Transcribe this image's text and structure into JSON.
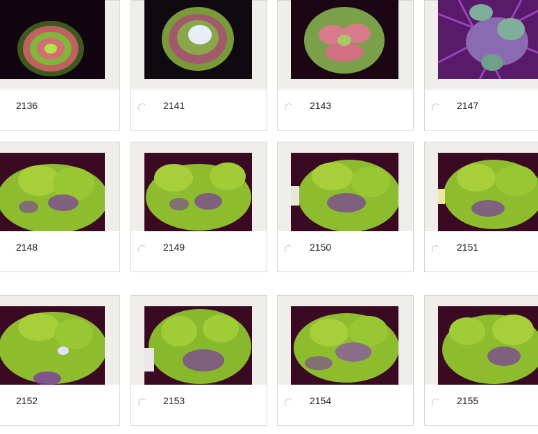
{
  "gallery": {
    "items": [
      {
        "label": "2136",
        "kind": "flower-green-pink"
      },
      {
        "label": "2141",
        "kind": "flower-green-white"
      },
      {
        "label": "2143",
        "kind": "brain-green-pink"
      },
      {
        "label": "2147",
        "kind": "purple-rock"
      },
      {
        "label": "2148",
        "kind": "green-carpet"
      },
      {
        "label": "2149",
        "kind": "green-carpet"
      },
      {
        "label": "2150",
        "kind": "green-carpet"
      },
      {
        "label": "2151",
        "kind": "green-carpet"
      },
      {
        "label": "2152",
        "kind": "green-carpet"
      },
      {
        "label": "2153",
        "kind": "green-carpet"
      },
      {
        "label": "2154",
        "kind": "green-carpet"
      },
      {
        "label": "2155",
        "kind": "green-carpet"
      }
    ]
  },
  "colors": {
    "frame": "#efeeea",
    "photo_bg": "#1a0612",
    "coral_green": "#9bd23a",
    "coral_purple": "#7a3aa0",
    "rock_purple": "#b24fe0"
  }
}
